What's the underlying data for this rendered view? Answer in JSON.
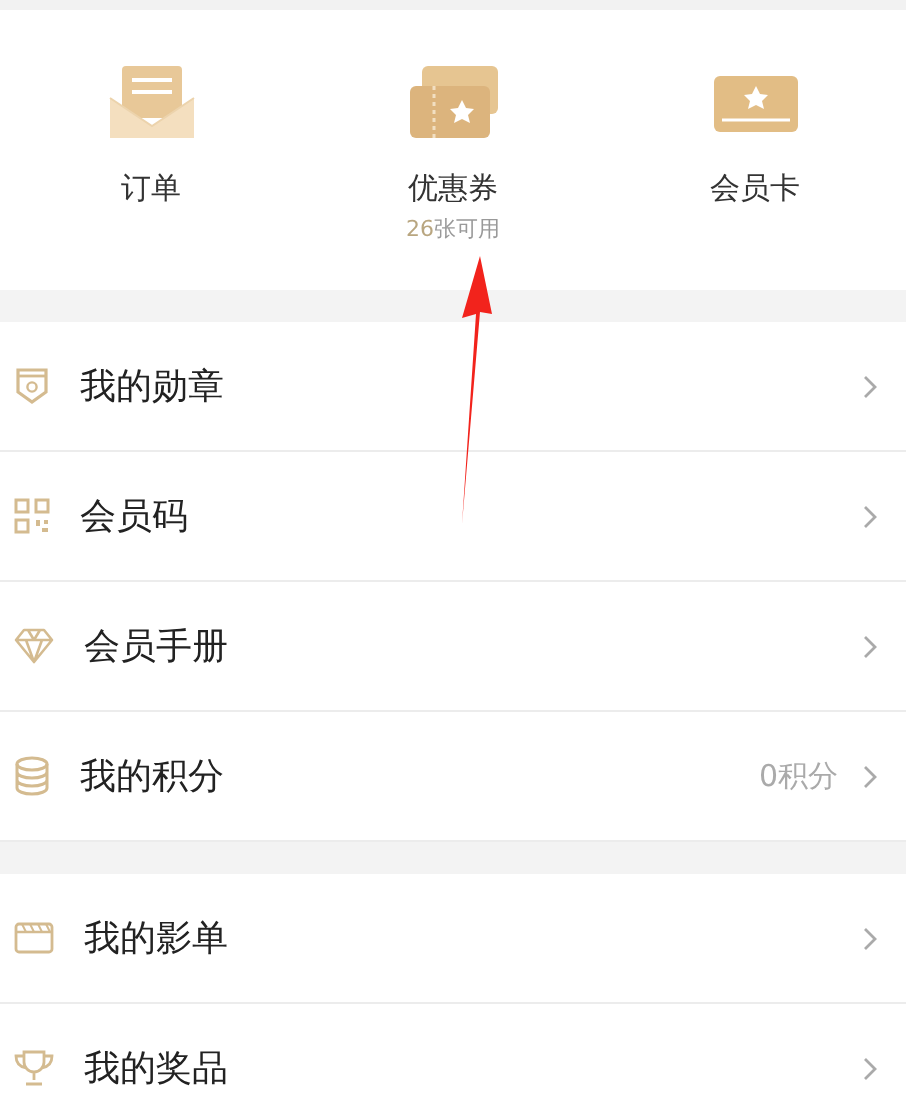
{
  "quick_links": [
    {
      "kind": "order",
      "label": "订单"
    },
    {
      "kind": "coupon",
      "label": "优惠券",
      "count": "26",
      "count_suffix": "张可用"
    },
    {
      "kind": "card",
      "label": "会员卡"
    }
  ],
  "menu_groups": [
    [
      {
        "kind": "badge",
        "label": "我的勋章"
      },
      {
        "kind": "qr",
        "label": "会员码"
      },
      {
        "kind": "diamond",
        "label": "会员手册"
      },
      {
        "kind": "coins",
        "label": "我的积分",
        "value": "0积分"
      }
    ],
    [
      {
        "kind": "film",
        "label": "我的影单"
      },
      {
        "kind": "trophy",
        "label": "我的奖品"
      }
    ]
  ],
  "annotation": {
    "kind": "arrow"
  }
}
